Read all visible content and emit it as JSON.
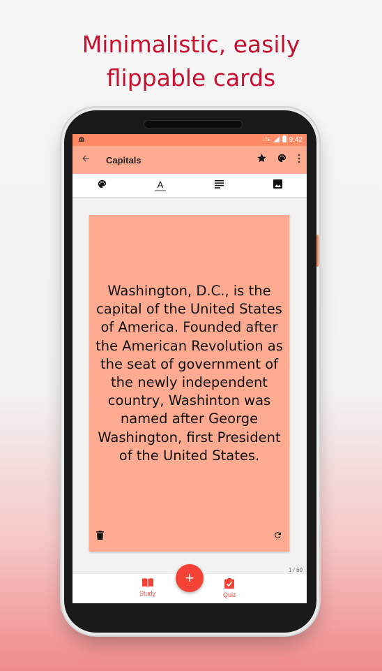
{
  "promo": {
    "line1": "Minimalistic, easily",
    "line2": "flippable cards"
  },
  "status_bar": {
    "time": "9:42",
    "network": "LTE",
    "icons": [
      "android-icon",
      "signal-icon",
      "battery-icon"
    ]
  },
  "app_bar": {
    "title": "Capitals",
    "icons": [
      "back-arrow-icon",
      "star-icon",
      "palette-icon",
      "more-vert-icon"
    ]
  },
  "format_toolbar": {
    "icons": [
      "palette-icon",
      "text-color-icon",
      "align-icon",
      "image-icon"
    ],
    "text_color_glyph": "A"
  },
  "card": {
    "text": "Washington, D.C., is the capital of the United States of America. Founded after the American Revolution as the seat of government of the newly independent country, Washinton was named after George Washington, first President of the United States.",
    "background": "#ffab91",
    "icons": [
      "delete-icon",
      "flip-icon"
    ]
  },
  "pager": {
    "label": "1 / 60"
  },
  "bottom_nav": {
    "study_label": "Study",
    "quiz_label": "Quiz",
    "fab_label": "+",
    "accent": "#f44336"
  },
  "colors": {
    "headline": "#c8102e",
    "status_bar": "#ff8a65",
    "app_bar": "#ffab91"
  }
}
